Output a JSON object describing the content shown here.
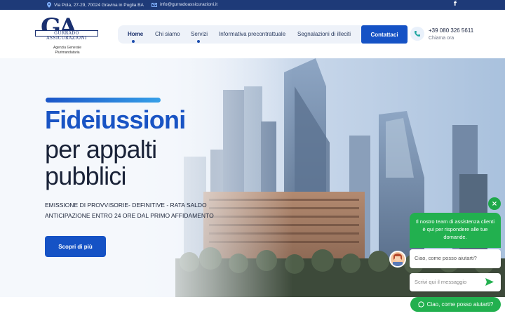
{
  "topbar": {
    "address": "Via Pola, 27-29, 70024 Gravina in Puglia BA",
    "email": "info@gurradoassicurazioni.it",
    "facebook": "f"
  },
  "logo": {
    "monogram": "GA",
    "name": "GURRADO ASSICURAZIONI",
    "sub_line1": "Agenzia Generale",
    "sub_line2": "Plurimandataria"
  },
  "nav": {
    "items": [
      {
        "label": "Home"
      },
      {
        "label": "Chi siamo"
      },
      {
        "label": "Servizi"
      },
      {
        "label": "Informativa precontrattuale"
      },
      {
        "label": "Segnalazioni di illeciti"
      }
    ],
    "cta": "Contattaci"
  },
  "contact": {
    "phone": "+39 080 326 5611",
    "call_label": "Chiama ora"
  },
  "hero": {
    "title_1": "Fideiussioni",
    "title_2": "per appalti",
    "title_3": "pubblici",
    "desc_1": "EMISSIONE DI PROVVISORIE- DEFINITIVE - RATA SALDO",
    "desc_2": "ANTICIPAZIONE ENTRO 24 ORE DAL PRIMO AFFIDAMENTO",
    "button": "Scopri di più"
  },
  "chat": {
    "close": "×",
    "intro": "Il nostro team di assistenza clienti è qui per rispondere alle tue domande.",
    "message": "Ciao, come posso aiutarti?",
    "input_placeholder": "Scrivi qui il messaggio",
    "bubble": "Ciao, come posso aiutarti?"
  },
  "colors": {
    "primary": "#1552c5",
    "topbar": "#1e3a78",
    "whatsapp": "#22b04f"
  }
}
